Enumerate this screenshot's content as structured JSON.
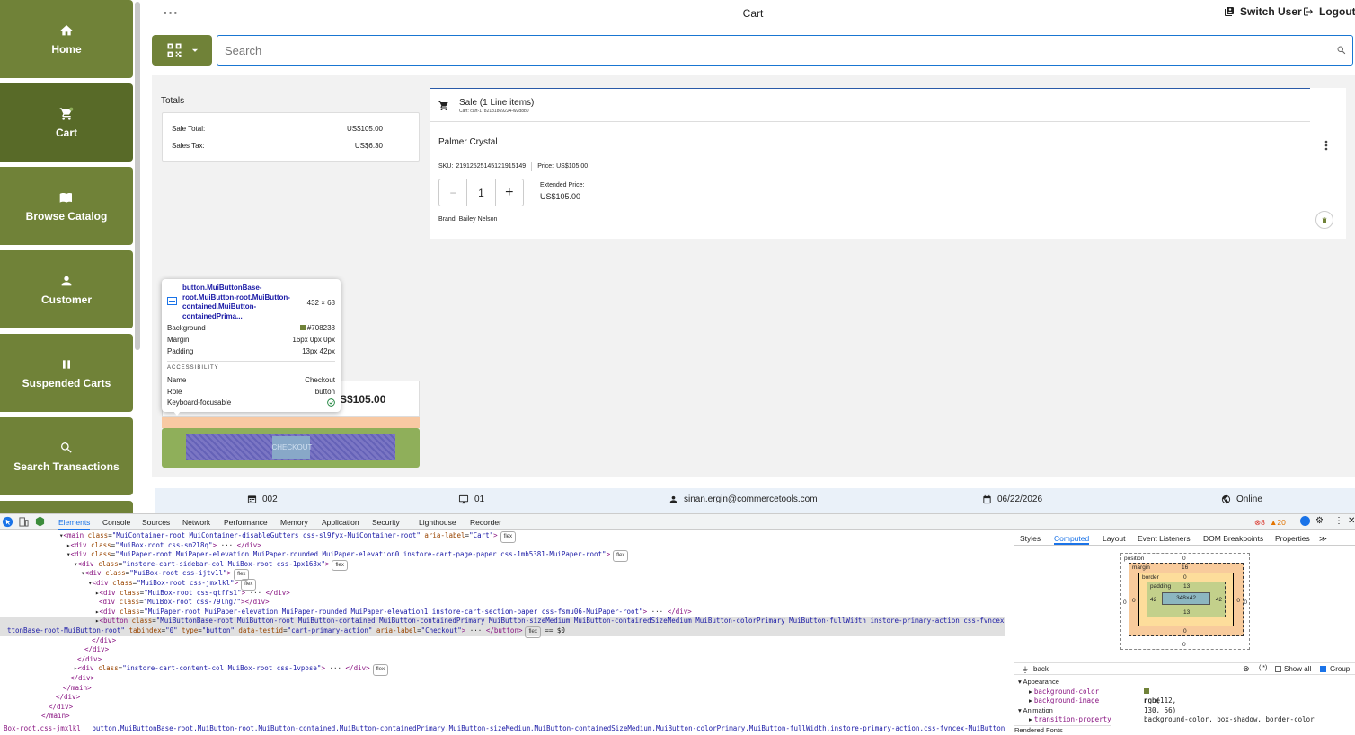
{
  "sidebar": {
    "items": [
      {
        "label": "Home",
        "icon": "home-icon"
      },
      {
        "label": "Cart",
        "icon": "cart-icon"
      },
      {
        "label": "Browse Catalog",
        "icon": "book-icon"
      },
      {
        "label": "Customer",
        "icon": "person-icon"
      },
      {
        "label": "Suspended Carts",
        "icon": "pause-icon"
      },
      {
        "label": "Search Transactions",
        "icon": "search-icon"
      }
    ],
    "active": "Cart"
  },
  "header": {
    "menu_dots": "···",
    "title": "Cart",
    "switch_user": "Switch User",
    "logout": "Logout"
  },
  "search": {
    "placeholder": "Search"
  },
  "totals": {
    "label": "Totals",
    "sale_total_label": "Sale Total:",
    "sale_total_value": "US$105.00",
    "sales_tax_label": "Sales Tax:",
    "sales_tax_value": "US$6.30",
    "total_value_visible": "S$105.00"
  },
  "sale": {
    "title": "Sale (1 Line items)",
    "cart_id": "Cart: cart-1782181869224-w2d8b0",
    "item": {
      "name": "Palmer Crystal",
      "sku_label": "SKU:",
      "sku": "21912525145121915149",
      "price_label": "Price:",
      "price": "US$105.00",
      "quantity": "1",
      "minus": "−",
      "plus": "+",
      "extended_label": "Extended Price:",
      "extended_value": "US$105.00",
      "brand": "Brand: Bailey Nelson"
    }
  },
  "checkout": {
    "label": "CHECKOUT"
  },
  "inspect_tooltip": {
    "selector": "button.MuiButtonBase-root.MuiButton-root.MuiButton-contained.MuiButton-containedPrima...",
    "size": "432 × 68",
    "background_label": "Background",
    "background_value": "#708238",
    "margin_label": "Margin",
    "margin_value": "16px 0px 0px",
    "padding_label": "Padding",
    "padding_value": "13px 42px",
    "accessibility_heading": "ACCESSIBILITY",
    "name_label": "Name",
    "name_value": "Checkout",
    "role_label": "Role",
    "role_value": "button",
    "focusable_label": "Keyboard-focusable"
  },
  "status_bar": {
    "register": "002",
    "terminal": "01",
    "user": "sinan.ergin@commercetools.com",
    "date": "06/22/2026",
    "connection": "Online"
  },
  "devtools": {
    "tabs": [
      "Elements",
      "Console",
      "Sources",
      "Network",
      "Performance",
      "Memory",
      "Application",
      "Security",
      "Lighthouse",
      "Recorder"
    ],
    "selected_tab": "Elements",
    "errors": "8",
    "warnings": "20",
    "side_tabs": [
      "Styles",
      "Computed",
      "Layout",
      "Event Listeners",
      "DOM Breakpoints",
      "Properties"
    ],
    "side_selected": "Computed",
    "breadcrumb_left": "Box-root.css-jmxlkl",
    "breadcrumb_main": "button.MuiButtonBase-root.MuiButton-root.MuiButton-contained.MuiButton-containedPrimary.MuiButton-sizeMedium.MuiButton-containedSizeMedium.MuiButton-colorPrimary.MuiButton-fullWidth.instore-primary-action.css-fvncex-MuiButtonBase-root-MuiButton-root",
    "filter_value": "back",
    "show_all": "Show all",
    "group": "Group",
    "box_model": {
      "position_label": "position",
      "position": "0",
      "margin_label": "margin",
      "margin_top": "16",
      "margin_side": "0",
      "margin_bottom": "0",
      "border_label": "border",
      "border": "0",
      "padding_label": "padding",
      "padding_top": "13",
      "padding_side": "42",
      "padding_bottom": "13",
      "content": "348×42",
      "outer_side": "0",
      "outer_bottom": "0"
    },
    "computed": {
      "group1": "Appearance",
      "bg_color_prop": "background-color",
      "bg_color_val": "rgb(112, 130, 56)",
      "bg_image_prop": "background-image",
      "bg_image_val": "none",
      "group2": "Animation",
      "transition_prop": "transition-property",
      "transition_val": "background-color, box-shadow, border-color",
      "rendered_fonts": "Rendered Fonts"
    }
  },
  "colors": {
    "brand": "#708238",
    "brand_dark": "#586a28",
    "link_blue": "#1976d2"
  }
}
